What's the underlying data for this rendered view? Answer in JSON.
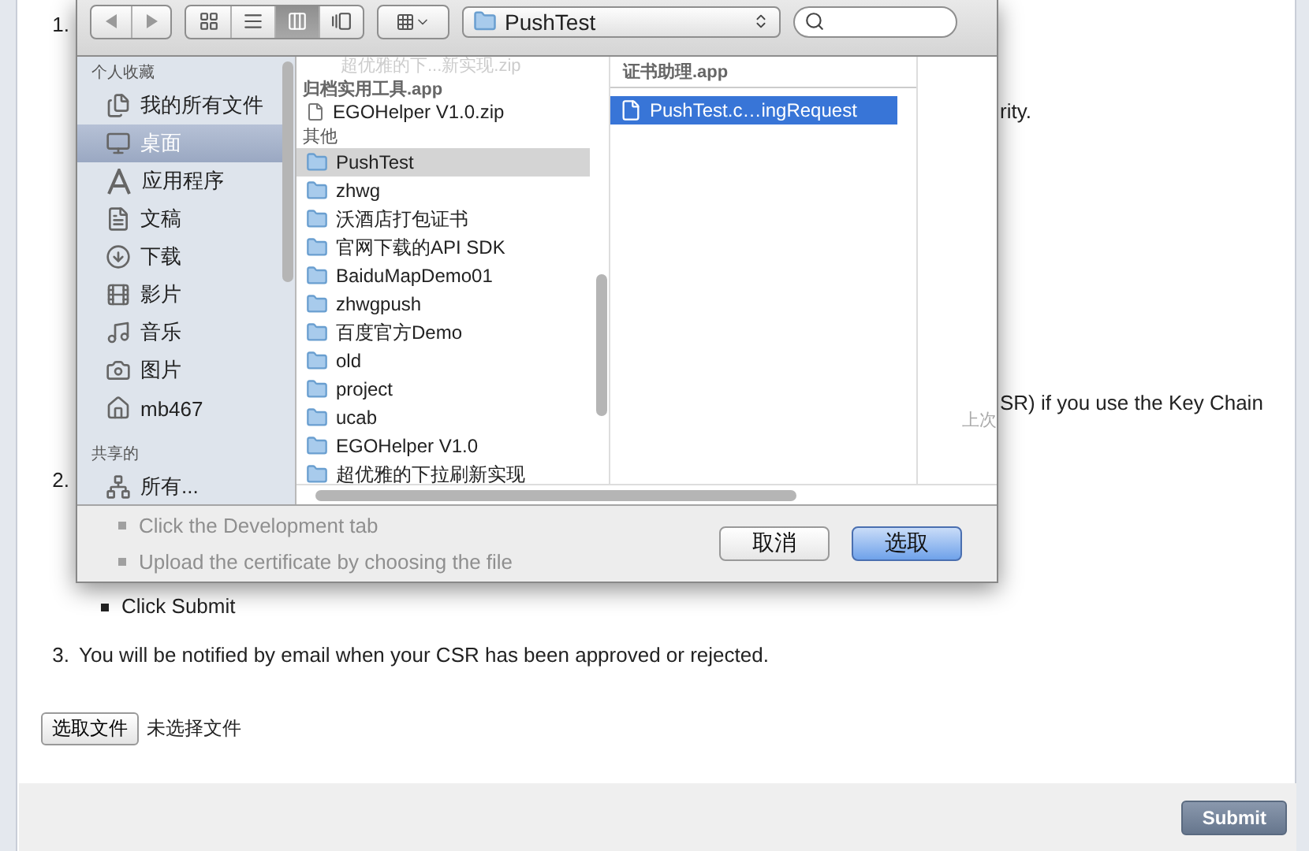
{
  "instructions": {
    "steps": [
      {
        "number": "1.",
        "fragments": [
          "rity.",
          "SR) if you use the Key Chain"
        ]
      },
      {
        "number": "2.",
        "bullets": [
          {
            "text": "Click the Development tab",
            "obscured": true
          },
          {
            "text": "Upload the certificate by choosing the file",
            "obscured": true
          },
          {
            "text": "Click Submit",
            "obscured": false
          }
        ]
      },
      {
        "number": "3.",
        "text": "You will be notified by email when your CSR has been approved or rejected."
      }
    ]
  },
  "file_input": {
    "button": "选取文件",
    "status": "未选择文件"
  },
  "form_footer": {
    "submit": "Submit"
  },
  "dialog": {
    "toolbar": {
      "view_modes": [
        {
          "kind": "icons",
          "selected": false
        },
        {
          "kind": "list",
          "selected": false
        },
        {
          "kind": "columns",
          "selected": true
        },
        {
          "kind": "coverflow",
          "selected": false
        }
      ],
      "path": "PushTest"
    },
    "sidebar": {
      "sections": [
        {
          "title": "个人收藏",
          "items": [
            {
              "kind": "all-files",
              "label": "我的所有文件",
              "selected": false
            },
            {
              "kind": "desktop",
              "label": "桌面",
              "selected": true
            },
            {
              "kind": "applications",
              "label": "应用程序",
              "selected": false
            },
            {
              "kind": "documents",
              "label": "文稿",
              "selected": false
            },
            {
              "kind": "downloads",
              "label": "下载",
              "selected": false
            },
            {
              "kind": "movies",
              "label": "影片",
              "selected": false
            },
            {
              "kind": "music",
              "label": "音乐",
              "selected": false
            },
            {
              "kind": "pictures",
              "label": "图片",
              "selected": false
            },
            {
              "kind": "home",
              "label": "mb467",
              "selected": false
            }
          ]
        },
        {
          "title": "共享的",
          "items": [
            {
              "kind": "network",
              "label": "所有...",
              "selected": false
            }
          ]
        }
      ]
    },
    "column_1": {
      "ghost": "超优雅的下...新实现.zip",
      "header": "归档实用工具.app",
      "files": [
        "EGOHelper V1.0.zip"
      ],
      "section": "其他",
      "folders": [
        {
          "name": "PushTest",
          "selected": true
        },
        {
          "name": "zhwg",
          "selected": false
        },
        {
          "name": "沃酒店打包证书",
          "selected": false
        },
        {
          "name": "官网下载的API SDK",
          "selected": false
        },
        {
          "name": "BaiduMapDemo01",
          "selected": false
        },
        {
          "name": "zhwgpush",
          "selected": false
        },
        {
          "name": "百度官方Demo",
          "selected": false
        },
        {
          "name": "old",
          "selected": false
        },
        {
          "name": "project",
          "selected": false
        },
        {
          "name": "ucab",
          "selected": false
        },
        {
          "name": "EGOHelper V1.0",
          "selected": false
        },
        {
          "name": "超优雅的下拉刷新实现",
          "selected": false
        }
      ]
    },
    "column_2": {
      "header": "证书助理.app",
      "files": [
        {
          "name": "PushTest.c…ingRequest",
          "selected": true
        }
      ]
    },
    "column_3": {
      "text": "上次"
    },
    "buttons": [
      {
        "kind": "cancel",
        "label": "取消"
      },
      {
        "kind": "default",
        "label": "选取"
      }
    ]
  }
}
